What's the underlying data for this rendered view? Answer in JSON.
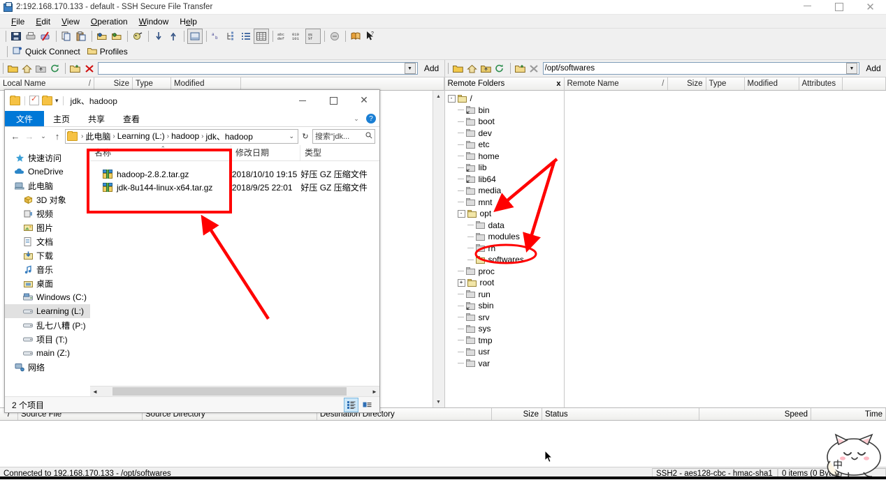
{
  "window": {
    "title": "2:192.168.170.133 - default - SSH Secure File Transfer",
    "minimize": "–",
    "maximize": "□",
    "close": "✕"
  },
  "menu": [
    "File",
    "Edit",
    "View",
    "Operation",
    "Window",
    "Help"
  ],
  "quickbar": {
    "quick_connect": "Quick Connect",
    "profiles": "Profiles"
  },
  "local_path": {
    "value": "",
    "placeholder": "",
    "add_label": "Add"
  },
  "remote_path": {
    "value": "/opt/softwares",
    "placeholder": "",
    "add_label": "Add"
  },
  "local_columns": [
    "Local Name",
    "Size",
    "Type",
    "Modified"
  ],
  "remote_columns": [
    "Remote Name",
    "Size",
    "Type",
    "Modified",
    "Attributes"
  ],
  "sort_mark": "/",
  "remote_tree": {
    "header": "Remote Folders",
    "close": "x",
    "nodes": [
      {
        "label": "/",
        "depth": 0,
        "expander": "-",
        "icon": "folder-open-yellow"
      },
      {
        "label": "bin",
        "depth": 1,
        "expander": "",
        "icon": "folder-link"
      },
      {
        "label": "boot",
        "depth": 1,
        "expander": "",
        "icon": "folder"
      },
      {
        "label": "dev",
        "depth": 1,
        "expander": "",
        "icon": "folder"
      },
      {
        "label": "etc",
        "depth": 1,
        "expander": "",
        "icon": "folder"
      },
      {
        "label": "home",
        "depth": 1,
        "expander": "",
        "icon": "folder"
      },
      {
        "label": "lib",
        "depth": 1,
        "expander": "",
        "icon": "folder-link"
      },
      {
        "label": "lib64",
        "depth": 1,
        "expander": "",
        "icon": "folder-link"
      },
      {
        "label": "media",
        "depth": 1,
        "expander": "",
        "icon": "folder"
      },
      {
        "label": "mnt",
        "depth": 1,
        "expander": "",
        "icon": "folder"
      },
      {
        "label": "opt",
        "depth": 1,
        "expander": "-",
        "icon": "folder-open-yellow"
      },
      {
        "label": "data",
        "depth": 2,
        "expander": "",
        "icon": "folder"
      },
      {
        "label": "modules",
        "depth": 2,
        "expander": "",
        "icon": "folder"
      },
      {
        "label": "rh",
        "depth": 2,
        "expander": "",
        "icon": "folder"
      },
      {
        "label": "softwares",
        "depth": 2,
        "expander": "",
        "icon": "folder-open-yellow",
        "selected": true
      },
      {
        "label": "proc",
        "depth": 1,
        "expander": "",
        "icon": "folder"
      },
      {
        "label": "root",
        "depth": 1,
        "expander": "+",
        "icon": "folder-yellow"
      },
      {
        "label": "run",
        "depth": 1,
        "expander": "",
        "icon": "folder"
      },
      {
        "label": "sbin",
        "depth": 1,
        "expander": "",
        "icon": "folder-link"
      },
      {
        "label": "srv",
        "depth": 1,
        "expander": "",
        "icon": "folder"
      },
      {
        "label": "sys",
        "depth": 1,
        "expander": "",
        "icon": "folder"
      },
      {
        "label": "tmp",
        "depth": 1,
        "expander": "",
        "icon": "folder"
      },
      {
        "label": "usr",
        "depth": 1,
        "expander": "",
        "icon": "folder"
      },
      {
        "label": "var",
        "depth": 1,
        "expander": "",
        "icon": "folder"
      }
    ]
  },
  "explorer": {
    "title": "jdk、hadoop",
    "ribbon_tabs": [
      "文件",
      "主页",
      "共享",
      "查看"
    ],
    "active_tab": "文件",
    "help": "?",
    "nav_back": "←",
    "nav_forward": "→",
    "nav_recent": "⌄",
    "nav_up": "↑",
    "breadcrumb": [
      "此电脑",
      "Learning (L:)",
      "hadoop",
      "jdk、hadoop"
    ],
    "breadcrumb_separator": "›",
    "refresh": "↻",
    "search_placeholder": "搜索\"jdk...",
    "search_icon": "🔍",
    "nav_items": [
      {
        "label": "快速访问",
        "icon": "star",
        "indent": false
      },
      {
        "label": "OneDrive",
        "icon": "cloud",
        "indent": false
      },
      {
        "label": "此电脑",
        "icon": "pc",
        "indent": false
      },
      {
        "label": "3D 对象",
        "icon": "box",
        "indent": true
      },
      {
        "label": "视频",
        "icon": "video",
        "indent": true
      },
      {
        "label": "图片",
        "icon": "picture",
        "indent": true
      },
      {
        "label": "文档",
        "icon": "document",
        "indent": true
      },
      {
        "label": "下载",
        "icon": "download",
        "indent": true
      },
      {
        "label": "音乐",
        "icon": "music",
        "indent": true
      },
      {
        "label": "桌面",
        "icon": "desktop",
        "indent": true
      },
      {
        "label": "Windows (C:)",
        "icon": "drive-windows",
        "indent": true
      },
      {
        "label": "Learning (L:)",
        "icon": "drive",
        "indent": true,
        "selected": true
      },
      {
        "label": "乱七八糟 (P:)",
        "icon": "drive",
        "indent": true
      },
      {
        "label": "项目 (T:)",
        "icon": "drive",
        "indent": true
      },
      {
        "label": "main (Z:)",
        "icon": "drive",
        "indent": true
      },
      {
        "label": "网络",
        "icon": "network",
        "indent": false
      }
    ],
    "file_columns": [
      "名称",
      "修改日期",
      "类型"
    ],
    "files": [
      {
        "name": "hadoop-2.8.2.tar.gz",
        "modified": "2018/10/10 19:15",
        "type": "好压 GZ 压缩文件"
      },
      {
        "name": "jdk-8u144-linux-x64.tar.gz",
        "modified": "2018/9/25 22:01",
        "type": "好压 GZ 压缩文件"
      }
    ],
    "status": "2 个项目",
    "view_details_icon": "details-view-icon",
    "view_tiles_icon": "tiles-view-icon"
  },
  "transfer_columns": [
    "Source File",
    "Source Directory",
    "Destination Directory",
    "Size",
    "Status",
    "Speed",
    "Time"
  ],
  "transfer_sort_mark": "/",
  "statusbar": {
    "connection": "Connected to 192.168.170.133 - /opt/softwares",
    "cipher": "SSH2 - aes128-cbc - hmac-sha1",
    "items": "0 items (0 Bytes)"
  },
  "ime": {
    "mode": "中",
    "currency": "¥"
  },
  "colors": {
    "accent": "#0078d7",
    "annotation_red": "#ff0000",
    "folder_yellow": "#f2e6a8",
    "title_bg": "#ffffff"
  }
}
